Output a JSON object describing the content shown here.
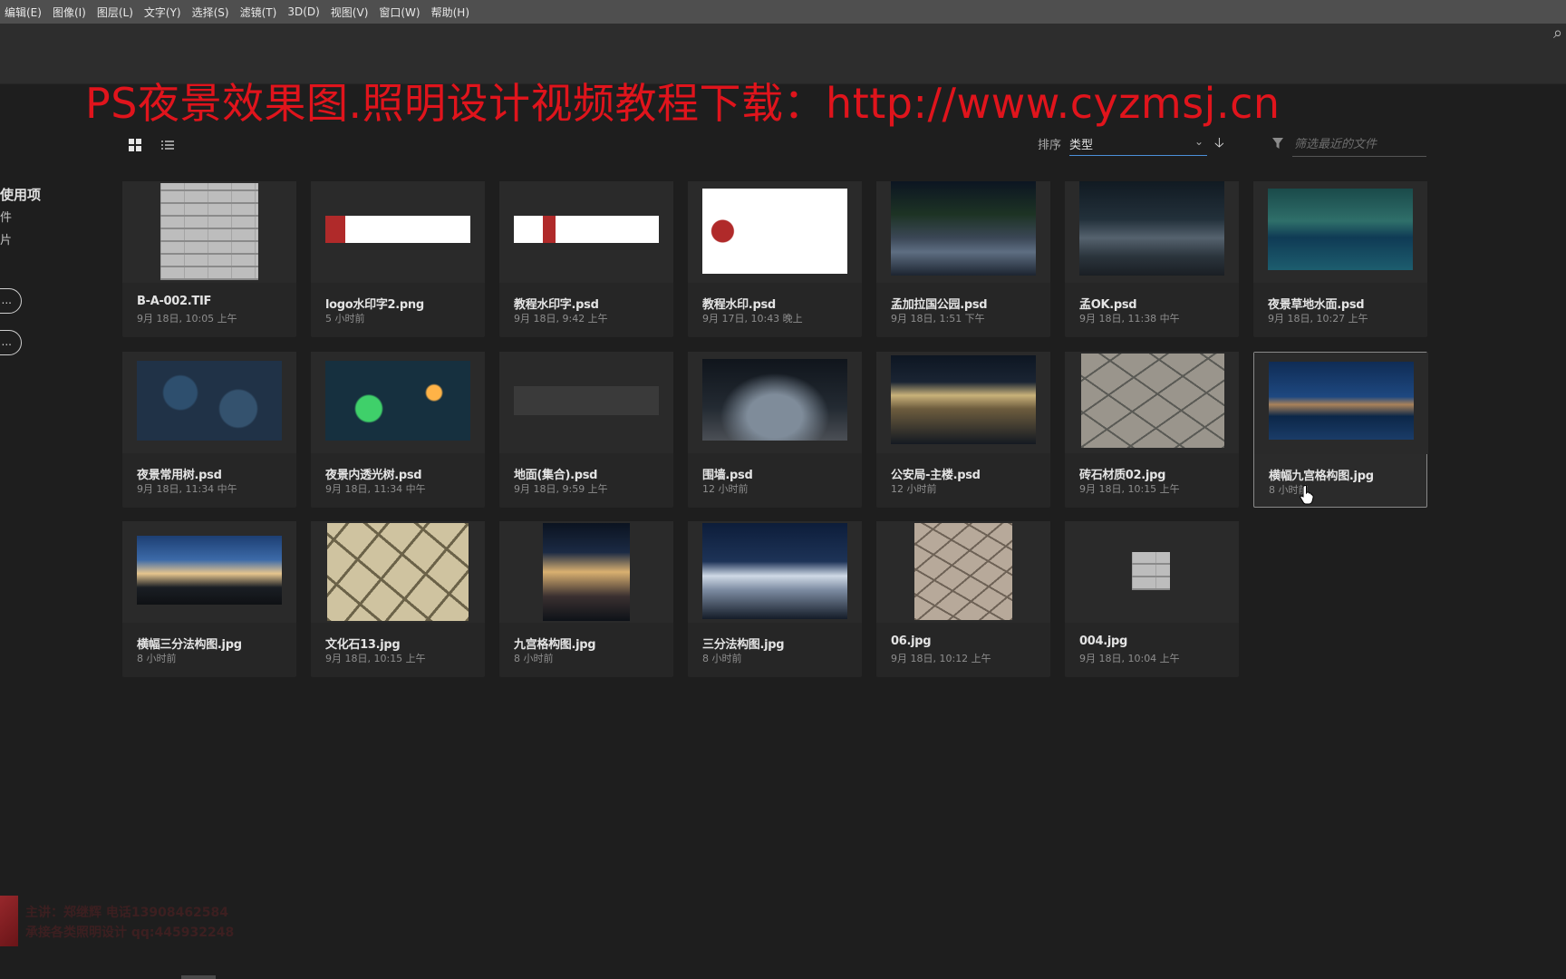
{
  "menubar": {
    "items": [
      "编辑(E)",
      "图像(I)",
      "图层(L)",
      "文字(Y)",
      "选择(S)",
      "滤镜(T)",
      "3D(D)",
      "视图(V)",
      "窗口(W)",
      "帮助(H)"
    ]
  },
  "watermark": {
    "text": "PS夜景效果图.照明设计视频教程下载：http://www.cyzmsj.cn",
    "color": "#e0141c"
  },
  "sidebar": {
    "heading": "使用项",
    "frag1": "件",
    "frag2": "片",
    "btn1": "...",
    "btn2": "..."
  },
  "toolbar": {
    "sort_label": "排序",
    "sort_value": "类型",
    "filter_placeholder": "筛选最近的文件"
  },
  "files": [
    {
      "name": "B-A-002.TIF",
      "date": "9月 18日, 10:05 上午",
      "thumb": "brick"
    },
    {
      "name": "logo水印字2.png",
      "date": "5 小时前",
      "thumb": "logo-wide"
    },
    {
      "name": "教程水印字.psd",
      "date": "9月 18日, 9:42 上午",
      "thumb": "logo-thin"
    },
    {
      "name": "教程水印.psd",
      "date": "9月 17日, 10:43 晚上",
      "thumb": "logo-tall"
    },
    {
      "name": "孟加拉国公园.psd",
      "date": "9月 18日, 1:51 下午",
      "thumb": "night-park"
    },
    {
      "name": "孟OK.psd",
      "date": "9月 18日, 11:38 中午",
      "thumb": "night-steps"
    },
    {
      "name": "夜景草地水面.psd",
      "date": "9月 18日, 10:27 上午",
      "thumb": "water"
    },
    {
      "name": "夜景常用树.psd",
      "date": "9月 18日, 11:34 中午",
      "thumb": "trees-blue"
    },
    {
      "name": "夜景内透光树.psd",
      "date": "9月 18日, 11:34 中午",
      "thumb": "trees-green"
    },
    {
      "name": "地面(集合).psd",
      "date": "9月 18日, 9:59 上午",
      "thumb": "ground"
    },
    {
      "name": "围墙.psd",
      "date": "12 小时前",
      "thumb": "wall-night"
    },
    {
      "name": "公安局-主楼.psd",
      "date": "12 小时前",
      "thumb": "building-night"
    },
    {
      "name": "砖石材质02.jpg",
      "date": "9月 18日, 10:15 上午",
      "thumb": "stone-grey"
    },
    {
      "name": "横幅九宫格构图.jpg",
      "date": "8 小时前",
      "thumb": "lake-house",
      "selected": true
    },
    {
      "name": "横幅三分法构图.jpg",
      "date": "8 小时前",
      "thumb": "house-night"
    },
    {
      "name": "文化石13.jpg",
      "date": "9月 18日, 10:15 上午",
      "thumb": "stone-beige"
    },
    {
      "name": "九宫格构图.jpg",
      "date": "8 小时前",
      "thumb": "tower"
    },
    {
      "name": "三分法构图.jpg",
      "date": "8 小时前",
      "thumb": "white-building"
    },
    {
      "name": "06.jpg",
      "date": "9月 18日, 10:12 上午",
      "thumb": "stone-brown"
    },
    {
      "name": "004.jpg",
      "date": "9月 18日, 10:04 上午",
      "thumb": "brick-small"
    }
  ],
  "bottom_watermark": {
    "line1": "主讲：郑继辉  电话13908462584",
    "line2": "承接各类照明设计  qq:445932248"
  }
}
